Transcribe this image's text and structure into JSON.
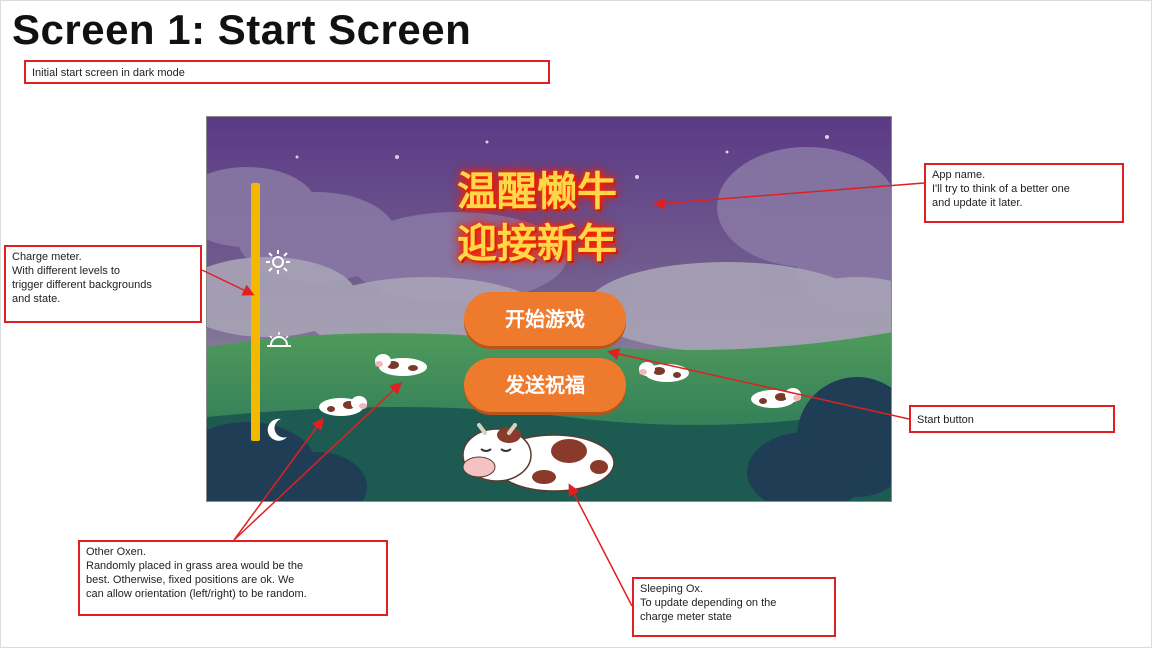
{
  "page": {
    "title": "Screen 1: Start Screen"
  },
  "notes": {
    "intro": "Initial start screen in dark mode",
    "app_name": {
      "line1": "App name.",
      "line2": "I'll try to think of a better one",
      "line3": "and update it later."
    },
    "charge_meter": {
      "line1": "Charge meter.",
      "line2": "With different levels to",
      "line3": "trigger different backgrounds",
      "line4": "and state."
    },
    "start_button": "Start button",
    "other_oxen": {
      "line1": "Other Oxen.",
      "line2": "Randomly placed in grass area would be the",
      "line3": "best.  Otherwise,  fixed positions are ok. We",
      "line4": "can allow orientation (left/right) to be random."
    },
    "sleeping_ox": {
      "line1": "Sleeping Ox.",
      "line2": "To update depending on the",
      "line3": "charge meter state"
    }
  },
  "app": {
    "title_line1": "温醒懒牛",
    "title_line2": "迎接新年",
    "start_button_label": "开始游戏",
    "send_button_label": "发送祝福",
    "meter_icons": [
      "sun-icon",
      "sunrise-icon",
      "moon-icon"
    ]
  },
  "colors": {
    "annotation_red": "#e02020",
    "sky_top": "#5b3a86",
    "button_orange": "#ee7a2e",
    "meter_yellow": "#f5b800",
    "title_yellow": "#ffd84a",
    "title_glow": "#ff2a00"
  }
}
